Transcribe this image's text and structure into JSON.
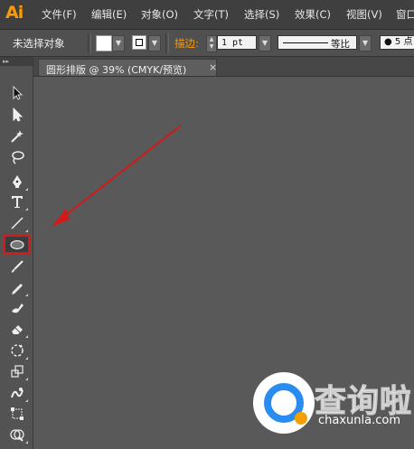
{
  "app": {
    "logo": "Ai"
  },
  "menubar": {
    "items": [
      "文件(F)",
      "编辑(E)",
      "对象(O)",
      "文字(T)",
      "选择(S)",
      "效果(C)",
      "视图(V)",
      "窗口"
    ]
  },
  "control_bar": {
    "selection_label": "未选择对象",
    "stroke_label": "描边:",
    "stroke_weight": "1 pt",
    "stroke_profile": "等比",
    "brush_value": "● 5 点"
  },
  "document_tab": {
    "title": "圆形排版 @ 39% (CMYK/预览)",
    "close_glyph": "×"
  },
  "tools": [
    {
      "name": "selection-tool-icon",
      "active": false
    },
    {
      "name": "direct-selection-tool-icon",
      "active": false
    },
    {
      "name": "magic-wand-tool-icon",
      "active": false
    },
    {
      "name": "lasso-tool-icon",
      "active": false
    },
    {
      "name": "pen-tool-icon",
      "active": false
    },
    {
      "name": "type-tool-icon",
      "active": false
    },
    {
      "name": "line-segment-tool-icon",
      "active": false
    },
    {
      "name": "ellipse-tool-icon",
      "active": true
    },
    {
      "name": "paintbrush-tool-icon",
      "active": false
    },
    {
      "name": "pencil-tool-icon",
      "active": false
    },
    {
      "name": "blob-brush-tool-icon",
      "active": false
    },
    {
      "name": "eraser-tool-icon",
      "active": false
    },
    {
      "name": "rotate-tool-icon",
      "active": false
    },
    {
      "name": "scale-tool-icon",
      "active": false
    },
    {
      "name": "warp-tool-icon",
      "active": false
    },
    {
      "name": "free-transform-tool-icon",
      "active": false
    },
    {
      "name": "shape-builder-tool-icon",
      "active": false
    }
  ],
  "annotation": {
    "arrow_color": "#d11a1a"
  },
  "watermark": {
    "text": "查询啦",
    "subtext": "chaxunla.com",
    "ring_color": "#2b8cf0",
    "dot_color": "#f4a000"
  },
  "colors": {
    "accent": "#ff9a00",
    "canvas": "#595959",
    "highlight": "#d11a1a"
  }
}
